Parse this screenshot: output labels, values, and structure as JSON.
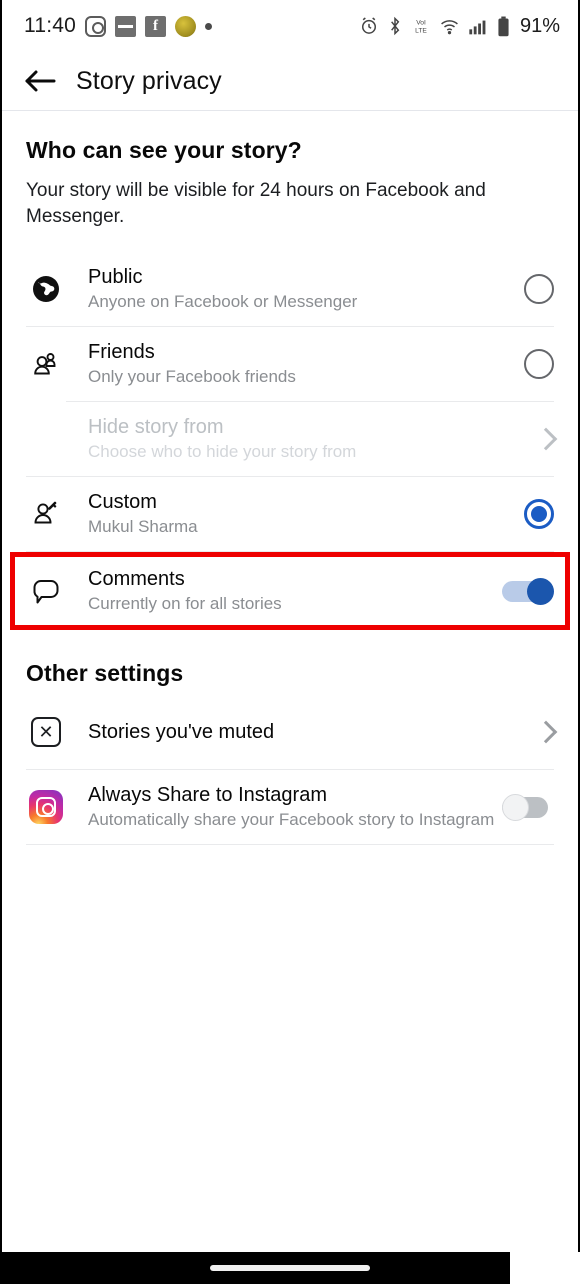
{
  "status_bar": {
    "time": "11:40",
    "battery_percent": "91%",
    "left_icons": [
      "instagram-icon",
      "news-icon",
      "facebook-icon",
      "coin-icon",
      "dot-icon"
    ],
    "right_icons": [
      "alarm-icon",
      "bluetooth-icon",
      "volte-icon",
      "wifi-icon",
      "signal-icon",
      "battery-icon"
    ]
  },
  "app_bar": {
    "back_label": "back-arrow",
    "title": "Story privacy"
  },
  "main": {
    "heading": "Who can see your story?",
    "description": "Your story will be visible for 24 hours on Facebook and Messenger.",
    "audience_options": [
      {
        "id": "public",
        "icon": "globe-icon",
        "title": "Public",
        "subtitle": "Anyone on Facebook or Messenger",
        "control": "radio",
        "selected": false,
        "disabled": false
      },
      {
        "id": "friends",
        "icon": "friends-icon",
        "title": "Friends",
        "subtitle": "Only your Facebook friends",
        "control": "radio",
        "selected": false,
        "disabled": false
      },
      {
        "id": "hide-story-from",
        "icon": "",
        "title": "Hide story from",
        "subtitle": "Choose who to hide your story from",
        "control": "chevron",
        "selected": false,
        "disabled": true
      },
      {
        "id": "custom",
        "icon": "person-edit-icon",
        "title": "Custom",
        "subtitle": "Mukul Sharma",
        "control": "radio",
        "selected": true,
        "disabled": false
      },
      {
        "id": "comments",
        "icon": "comment-bubble-icon",
        "title": "Comments",
        "subtitle": "Currently on for all stories",
        "control": "toggle",
        "toggle_on": true,
        "disabled": false,
        "highlighted": true
      }
    ],
    "other_settings": {
      "heading": "Other settings",
      "items": [
        {
          "id": "stories-youve-muted",
          "icon": "muted-x-icon",
          "title": "Stories you've muted",
          "subtitle": "",
          "control": "chevron"
        },
        {
          "id": "always-share-to-instagram",
          "icon": "instagram-icon",
          "title": "Always Share to Instagram",
          "subtitle": "Automatically share your Facebook story to Instagram",
          "control": "toggle",
          "toggle_on": false
        }
      ]
    }
  },
  "colors": {
    "accent_blue": "#1b5cc4",
    "toggle_on_thumb": "#1b56ad",
    "toggle_on_track": "#b9cbe8",
    "highlight_red": "#ee0000",
    "secondary_text": "#8a8d91",
    "disabled_text": "#bcc0c4"
  },
  "nav_bar": {
    "home_indicator": "home-indicator"
  }
}
